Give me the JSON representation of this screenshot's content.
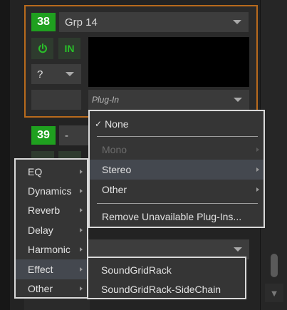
{
  "channel_38": {
    "number": "38",
    "name": "Grp 14",
    "power_icon": "power-icon",
    "input_label": "IN",
    "question_label": "?",
    "plugin_placeholder": "Plug-In"
  },
  "channel_39": {
    "number": "39",
    "name": "-"
  },
  "plugin_menu": {
    "items": [
      {
        "label": "None",
        "checked": true,
        "check_mark": "✓",
        "enabled": true
      },
      {
        "label": "Mono",
        "enabled": false,
        "submenu": true
      },
      {
        "label": "Stereo",
        "enabled": true,
        "submenu": true,
        "highlighted": true
      },
      {
        "label": "Other",
        "enabled": true,
        "submenu": true
      },
      {
        "label": "Remove Unavailable Plug-Ins...",
        "enabled": true
      }
    ]
  },
  "category_menu": {
    "items": [
      {
        "label": "EQ"
      },
      {
        "label": "Dynamics"
      },
      {
        "label": "Reverb"
      },
      {
        "label": "Delay"
      },
      {
        "label": "Harmonic"
      },
      {
        "label": "Effect",
        "highlighted": true
      },
      {
        "label": "Other"
      }
    ]
  },
  "effect_menu": {
    "items": [
      {
        "label": "SoundGridRack"
      },
      {
        "label": "SoundGridRack-SideChain"
      }
    ]
  },
  "colors": {
    "channel_number_bg": "#1fa01f",
    "selected_frame": "#b86a1d",
    "menu_border": "#d9d9d9",
    "highlight": "#44484f"
  }
}
